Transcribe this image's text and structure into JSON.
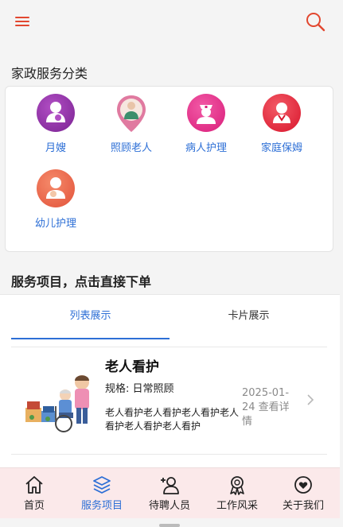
{
  "header": {
    "menu_icon": "hamburger-menu-icon",
    "search_icon": "search-icon",
    "accent": "#e2472f"
  },
  "categories": {
    "title": "家政服务分类",
    "items": [
      {
        "label": "月嫂",
        "icon": "maternity-nurse-icon",
        "color": "#8b2fa0"
      },
      {
        "label": "照顾老人",
        "icon": "elderly-care-pin-icon",
        "color": "#e07aa0"
      },
      {
        "label": "病人护理",
        "icon": "nurse-icon",
        "color": "#e8358f"
      },
      {
        "label": "家庭保姆",
        "icon": "nanny-icon",
        "color": "#e8283e"
      },
      {
        "label": "幼儿护理",
        "icon": "baby-care-icon",
        "color": "#ef6a4e"
      }
    ]
  },
  "services": {
    "title": "服务项目，点击直接下单",
    "tabs": [
      {
        "label": "列表展示",
        "active": true
      },
      {
        "label": "卡片展示",
        "active": false
      }
    ],
    "list": [
      {
        "name": "老人看护",
        "spec": "规格: 日常照顾",
        "desc": "老人看护老人看护老人看护老人看护老人看护老人看护",
        "date": "2025-01-24 查看详情",
        "image": "elderly-care-illustration"
      }
    ]
  },
  "tabbar": {
    "active_color": "#2d6fd6",
    "items": [
      {
        "label": "首页",
        "icon": "home-icon",
        "active": false
      },
      {
        "label": "服务项目",
        "icon": "layers-icon",
        "active": true
      },
      {
        "label": "待聘人员",
        "icon": "user-add-icon",
        "active": false
      },
      {
        "label": "工作风采",
        "icon": "award-ribbon-icon",
        "active": false
      },
      {
        "label": "关于我们",
        "icon": "heart-circle-icon",
        "active": false
      }
    ]
  }
}
